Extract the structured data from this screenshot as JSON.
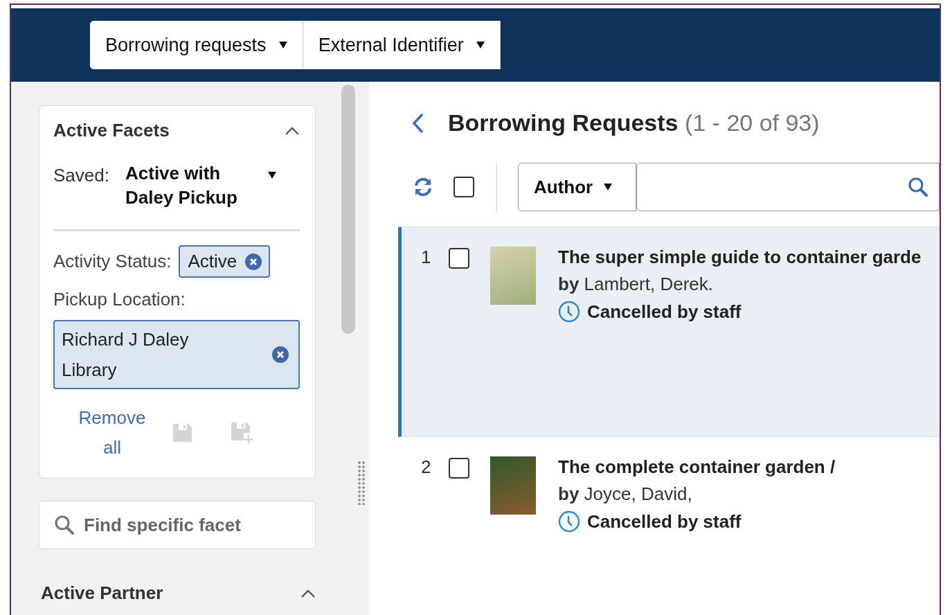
{
  "header": {
    "menus": [
      {
        "label": "Borrowing requests"
      },
      {
        "label": "External Identifier"
      }
    ]
  },
  "facets_panel": {
    "title": "Active Facets",
    "expanded": true,
    "saved_label": "Saved:",
    "saved_value": "Active with Daley Pickup",
    "filters": [
      {
        "kind": "inline",
        "label": "Activity Status:",
        "value": "Active"
      },
      {
        "kind": "block",
        "label": "Pickup Location:",
        "value": "Richard J Daley Library"
      }
    ],
    "remove_all": "Remove all"
  },
  "facet_search": {
    "placeholder": "Find specific facet"
  },
  "sections": [
    {
      "title": "Active Partner",
      "expanded": true
    }
  ],
  "list": {
    "title": "Borrowing Requests",
    "count": "(1 - 20 of 93)",
    "select_all_checked": false,
    "search_field": "Author",
    "rows": [
      {
        "number": "1",
        "checked": false,
        "selected": true,
        "title": "The super simple guide to container garde",
        "author": "**by** Lambert, Derek.",
        "status": "Cancelled by staff"
      },
      {
        "number": "2",
        "checked": false,
        "selected": false,
        "title": "The complete container garden /",
        "author": "**by** Joyce, David,",
        "status": "Cancelled by staff"
      }
    ]
  }
}
